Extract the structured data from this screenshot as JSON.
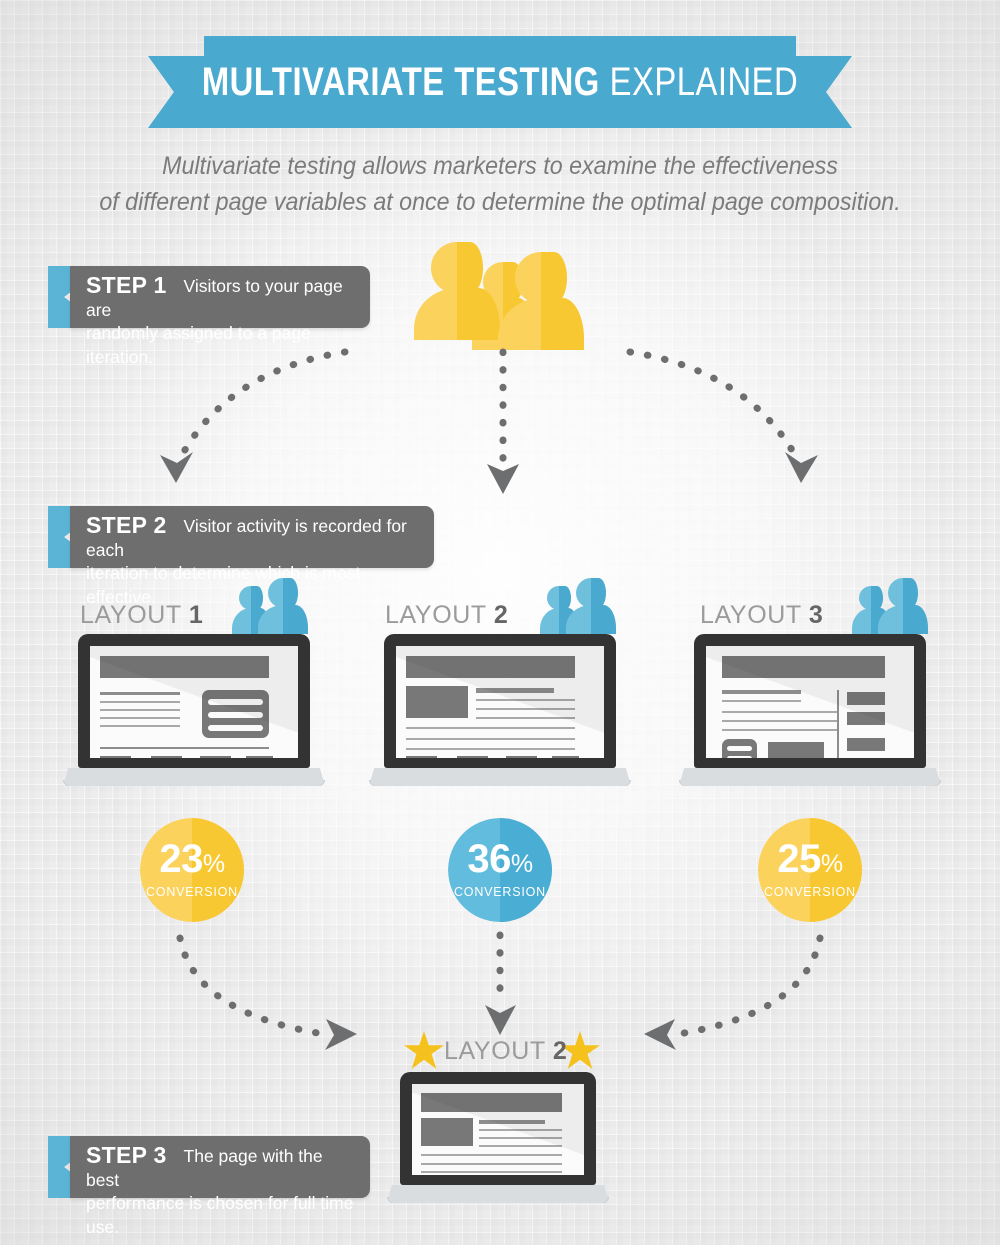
{
  "banner": {
    "title_strong": "MULTIVARIATE TESTING",
    "title_light": "EXPLAINED",
    "color": "#4aa9ce",
    "fold_color": "#3890b7"
  },
  "subtitle": {
    "line1": "Multivariate testing allows marketers to examine the effectiveness",
    "line2": "of different page variables at once to determine the optimal page composition."
  },
  "steps": [
    {
      "label": "STEP 1",
      "line1": "Visitors to your page are",
      "line2": "randomly assigned to a page iteration."
    },
    {
      "label": "STEP 2",
      "line1": "Visitor activity is recorded for each",
      "line2": "iteration to determine which is most effective."
    },
    {
      "label": "STEP 3",
      "line1": "The page with the best",
      "line2": "performance is chosen for full time use."
    }
  ],
  "icons": {
    "visitors_group": "people-group-icon",
    "layout_visitors": "people-pair-icon",
    "winner_star": "star-icon",
    "arrow": "dotted-arrow-icon",
    "laptop": "laptop-icon"
  },
  "variants": [
    {
      "caption_word": "LAYOUT",
      "caption_num": "1",
      "conversion_value": "23",
      "conversion_symbol": "%",
      "conversion_label": "CONVERSION",
      "circle_color": "#f8c833",
      "circle_color_light": "#fbd25c",
      "winner": false
    },
    {
      "caption_word": "LAYOUT",
      "caption_num": "2",
      "conversion_value": "36",
      "conversion_symbol": "%",
      "conversion_label": "CONVERSION",
      "circle_color": "#4aaed4",
      "circle_color_light": "#62bcdd",
      "winner": true
    },
    {
      "caption_word": "LAYOUT",
      "caption_num": "3",
      "conversion_value": "25",
      "conversion_symbol": "%",
      "conversion_label": "CONVERSION",
      "circle_color": "#f8c833",
      "circle_color_light": "#fbd25c",
      "winner": false
    }
  ],
  "winner": {
    "caption_word": "LAYOUT",
    "caption_num": "2"
  },
  "palette": {
    "blue": "#4aa9ce",
    "blue_light": "#6fc0dd",
    "yellow": "#f8c833",
    "yellow_light": "#fbd25c",
    "gray_dark": "#6e6e6e",
    "gray_text": "#7b7b7b",
    "wire_gray": "#787878",
    "star_gold": "#f5c21d",
    "arrow_gray": "#6d6e70"
  }
}
